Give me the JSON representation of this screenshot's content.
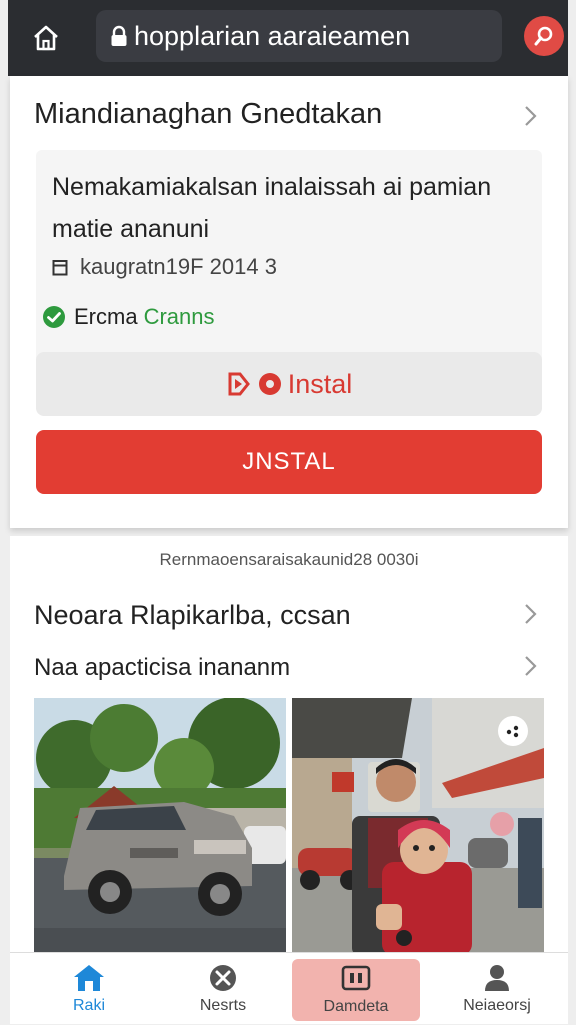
{
  "header": {
    "url_text": "hopplarian aaraieamen"
  },
  "card": {
    "title": "Miandianaghan Gnedtakan",
    "description": "Nemakamiakalsan inalaissah ai pamian matie ananuni",
    "date": "kaugratn19F 2014 3",
    "status_label": "Ercma",
    "status_value": "Cranns",
    "secondary_button_label": "Instal",
    "primary_button_label": "JNSTAL",
    "colors": {
      "accent": "#e23d33",
      "success": "#2e9a3e"
    }
  },
  "section": {
    "caption": "Rernmaoensaraisakaunid28 0030i",
    "title": "Neoara Rlapikarlba, ccsan",
    "subtitle": "Naa apacticisa inananm"
  },
  "bottom_nav": {
    "items": [
      {
        "label": "Raki",
        "icon": "home-icon",
        "active": true
      },
      {
        "label": "Nesrts",
        "icon": "close-circle-icon",
        "active": false
      },
      {
        "label": "Damdeta",
        "icon": "device-icon",
        "active": false
      },
      {
        "label": "Neiaeorsj",
        "icon": "person-icon",
        "active": false
      }
    ]
  }
}
